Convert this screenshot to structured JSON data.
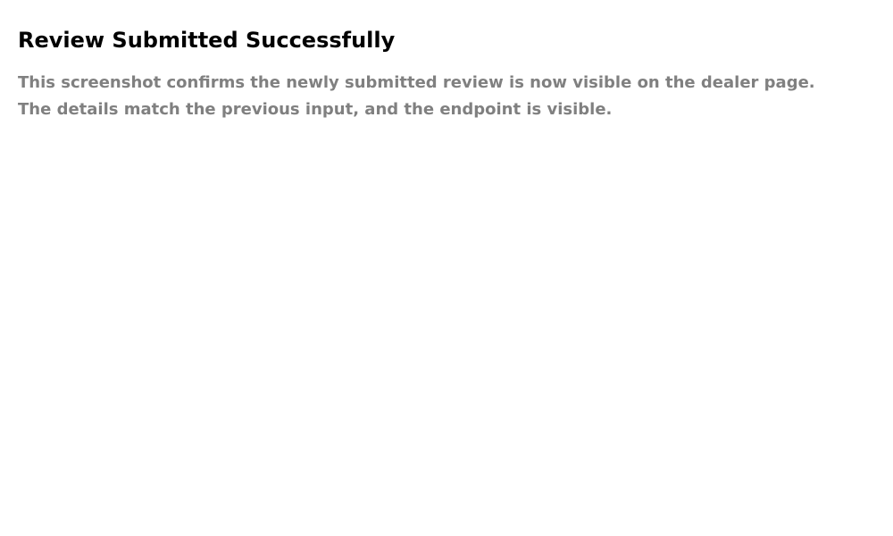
{
  "page": {
    "title": "Review Submitted Successfully",
    "description_lines": [
      "This screenshot confirms the newly submitted review is now visible on the dealer page.",
      "The details match the previous input, and the endpoint is visible."
    ]
  },
  "colors": {
    "background": "#ffffff",
    "title": "#000000",
    "description": "#808080"
  }
}
